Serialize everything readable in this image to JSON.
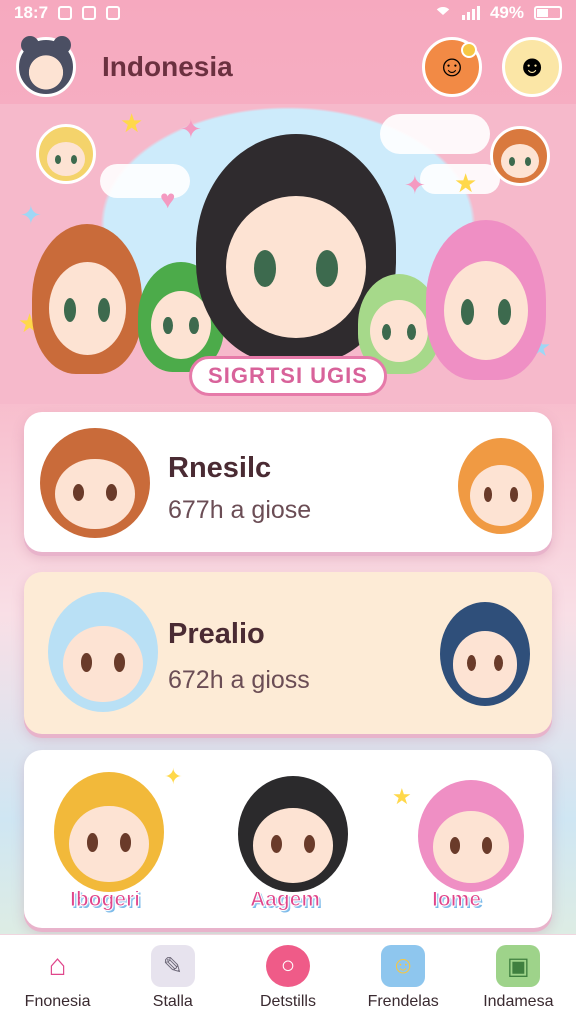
{
  "status_bar": {
    "time": "18:7",
    "battery": "49%"
  },
  "header": {
    "title": "Indonesia"
  },
  "hero": {
    "label": "SIGRTSI UGIS"
  },
  "cards": [
    {
      "title": "Rnesilc",
      "subtitle": "677h a giose"
    },
    {
      "title": "Prealio",
      "subtitle": "672h a gioss"
    },
    {
      "characters": [
        "Ibogeri",
        "Aagem",
        "Iome"
      ]
    }
  ],
  "tabs": [
    {
      "label": "Fnonesia",
      "icon": "home-icon"
    },
    {
      "label": "Stalla",
      "icon": "notes-icon"
    },
    {
      "label": "Detstills",
      "icon": "chat-bubble-icon"
    },
    {
      "label": "Frendelas",
      "icon": "friends-icon"
    },
    {
      "label": "Indamesa",
      "icon": "photo-icon"
    }
  ],
  "colors": {
    "accent": "#e0468b",
    "header_text": "#6b3140",
    "background": "#f6a9bf"
  }
}
